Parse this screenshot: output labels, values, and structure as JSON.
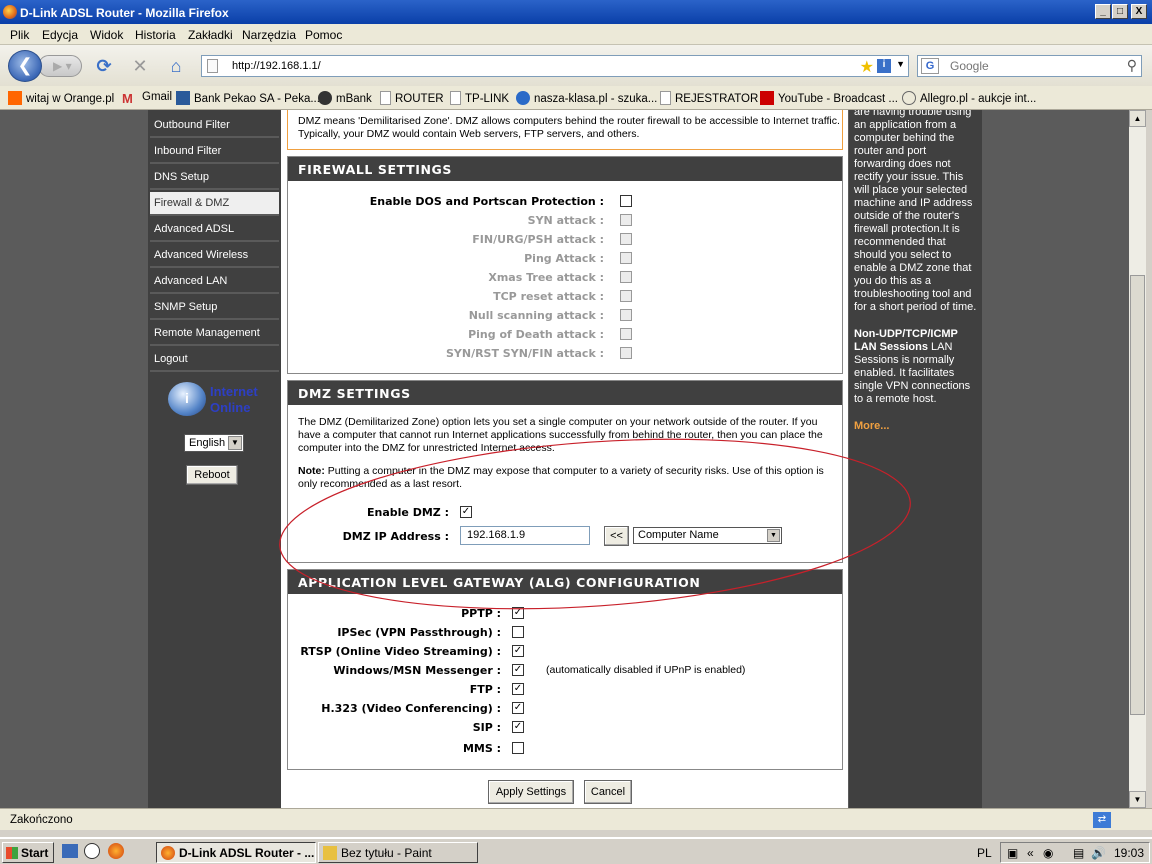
{
  "window": {
    "title": "D-Link ADSL Router - Mozilla Firefox",
    "buttons": [
      "_",
      "□",
      "X"
    ]
  },
  "menu": [
    "Plik",
    "Edycja",
    "Widok",
    "Historia",
    "Zakładki",
    "Narzędzia",
    "Pomoc"
  ],
  "nav": {
    "url": "http://192.168.1.1/",
    "search_placeholder": "Google",
    "search_engine_icon": "google-icon"
  },
  "bookmarks": [
    "witaj w Orange.pl",
    "Gmail",
    "Bank Pekao SA - Peka...",
    "mBank",
    "ROUTER",
    "TP-LINK",
    "nasza-klasa.pl - szuka...",
    "REJESTRATOR",
    "YouTube - Broadcast ...",
    "Allegro.pl - aukcje int..."
  ],
  "leftnav": {
    "items": [
      "Outbound Filter",
      "Inbound Filter",
      "DNS Setup",
      "Firewall & DMZ",
      "Advanced ADSL",
      "Advanced Wireless",
      "Advanced LAN",
      "SNMP Setup",
      "Remote Management",
      "Logout"
    ],
    "active": "Firewall & DMZ",
    "status_line1": "Internet",
    "status_line2": "Online",
    "language": "English",
    "reboot_label": "Reboot"
  },
  "intro": "DMZ means 'Demilitarised Zone'. DMZ allows computers behind the router firewall to be accessible to Internet traffic. Typically, your DMZ would contain Web servers, FTP servers, and others.",
  "firewall": {
    "heading": "FIREWALL SETTINGS",
    "rows": [
      {
        "label": "Enable DOS and Portscan Protection :",
        "checked": false,
        "disabled": false
      },
      {
        "label": "SYN attack :",
        "checked": false,
        "disabled": true
      },
      {
        "label": "FIN/URG/PSH attack :",
        "checked": false,
        "disabled": true
      },
      {
        "label": "Ping Attack :",
        "checked": false,
        "disabled": true
      },
      {
        "label": "Xmas Tree attack :",
        "checked": false,
        "disabled": true
      },
      {
        "label": "TCP reset attack :",
        "checked": false,
        "disabled": true
      },
      {
        "label": "Null scanning attack :",
        "checked": false,
        "disabled": true
      },
      {
        "label": "Ping of Death attack :",
        "checked": false,
        "disabled": true
      },
      {
        "label": "SYN/RST SYN/FIN attack :",
        "checked": false,
        "disabled": true
      }
    ]
  },
  "dmz": {
    "heading": "DMZ SETTINGS",
    "description": "The DMZ (Demilitarized Zone) option lets you set a single computer on your network outside of the router. If you have a computer that cannot run Internet applications successfully from behind the router, then you can place the computer into the DMZ for unrestricted Internet access.",
    "note_label": "Note:",
    "note_text": " Putting a computer in the DMZ may expose that computer to a variety of security risks. Use of this option is only recommended as a last resort.",
    "enable_label": "Enable DMZ :",
    "enable_checked": true,
    "ip_label": "DMZ IP Address :",
    "ip_value": "192.168.1.9",
    "copy_button": "<<",
    "computer_name": "Computer Name"
  },
  "alg": {
    "heading": "APPLICATION LEVEL GATEWAY (ALG) CONFIGURATION",
    "rows": [
      {
        "label": "PPTP :",
        "checked": true,
        "note": ""
      },
      {
        "label": "IPSec (VPN Passthrough) :",
        "checked": false,
        "note": ""
      },
      {
        "label": "RTSP (Online Video Streaming) :",
        "checked": true,
        "note": ""
      },
      {
        "label": "Windows/MSN Messenger :",
        "checked": true,
        "note": "(automatically disabled if UPnP is enabled)"
      },
      {
        "label": "FTP :",
        "checked": true,
        "note": ""
      },
      {
        "label": "H.323 (Video Conferencing) :",
        "checked": true,
        "note": ""
      },
      {
        "label": "SIP :",
        "checked": true,
        "note": ""
      },
      {
        "label": "MMS :",
        "checked": false,
        "note": ""
      }
    ]
  },
  "buttons": {
    "apply": "Apply Settings",
    "cancel": "Cancel"
  },
  "help": {
    "text1": "are having trouble using an application from a computer behind the router and port forwarding does not rectify your issue. This will place your selected machine and IP address outside of the router's firewall protection.It is recommended that should you select to enable a DMZ zone that you do this as a troubleshooting tool and for a short period of time.",
    "title2": "Non-UDP/TCP/ICMP LAN Sessions",
    "text2": " LAN Sessions is normally enabled. It facilitates single VPN connections to a remote host.",
    "more": "More..."
  },
  "statusbar": {
    "text": "Zakończono"
  },
  "taskbar": {
    "start": "Start",
    "tasks": [
      "D-Link ADSL Router - ...",
      "Bez tytułu - Paint"
    ],
    "lang": "PL",
    "time": "19:03"
  }
}
